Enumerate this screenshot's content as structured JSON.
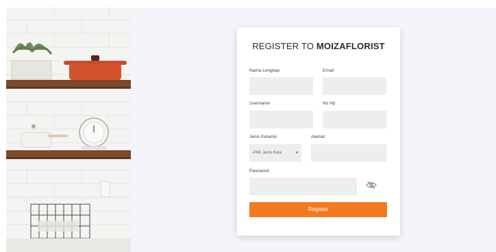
{
  "form": {
    "title_prefix": "REGISTER TO ",
    "title_brand": "MOIZAFLORIST",
    "labels": {
      "nama": "Nama Lengkap",
      "email": "Email",
      "username": "Username",
      "nohp": "No Hp",
      "gender": "Jenis Kelamin",
      "alamat": "Alamat",
      "password": "Password"
    },
    "gender_select": {
      "selected": "-Pilih Jenis Kela"
    },
    "submit_label": "Register"
  },
  "colors": {
    "accent": "#f47a20",
    "field_bg": "#eeeeee",
    "page_bg": "#f3f5fa"
  },
  "icons": {
    "password_toggle": "eye-slash-icon",
    "select_caret": "chevron-down-icon"
  }
}
